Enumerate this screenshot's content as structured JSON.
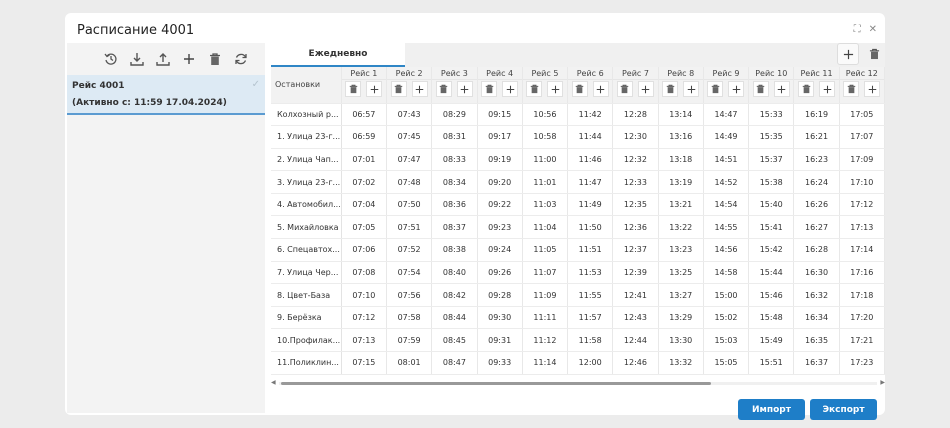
{
  "dialog": {
    "title": "Расписание 4001"
  },
  "trips": [
    {
      "name": "Рейс 4001",
      "active": "(Активно с: 11:59 17.04.2024)"
    }
  ],
  "tab": {
    "label": "Ежедневно"
  },
  "table": {
    "stops_header": "Остановки",
    "columns": [
      "Рейс 1",
      "Рейс 2",
      "Рейс 3",
      "Рейс 4",
      "Рейс 5",
      "Рейс 6",
      "Рейс 7",
      "Рейс 8",
      "Рейс 9",
      "Рейс 10",
      "Рейс 11",
      "Рейс 12"
    ],
    "rows": [
      {
        "stop": "Колхозный р...",
        "times": [
          "06:57",
          "07:43",
          "08:29",
          "09:15",
          "10:56",
          "11:42",
          "12:28",
          "13:14",
          "14:47",
          "15:33",
          "16:19",
          "17:05"
        ]
      },
      {
        "stop": "1. Улица 23-г...",
        "times": [
          "06:59",
          "07:45",
          "08:31",
          "09:17",
          "10:58",
          "11:44",
          "12:30",
          "13:16",
          "14:49",
          "15:35",
          "16:21",
          "17:07"
        ]
      },
      {
        "stop": "2. Улица Чап...",
        "times": [
          "07:01",
          "07:47",
          "08:33",
          "09:19",
          "11:00",
          "11:46",
          "12:32",
          "13:18",
          "14:51",
          "15:37",
          "16:23",
          "17:09"
        ]
      },
      {
        "stop": "3. Улица 23-г...",
        "times": [
          "07:02",
          "07:48",
          "08:34",
          "09:20",
          "11:01",
          "11:47",
          "12:33",
          "13:19",
          "14:52",
          "15:38",
          "16:24",
          "17:10"
        ]
      },
      {
        "stop": "4. Автомобил...",
        "times": [
          "07:04",
          "07:50",
          "08:36",
          "09:22",
          "11:03",
          "11:49",
          "12:35",
          "13:21",
          "14:54",
          "15:40",
          "16:26",
          "17:12"
        ]
      },
      {
        "stop": "5. Михайловка",
        "times": [
          "07:05",
          "07:51",
          "08:37",
          "09:23",
          "11:04",
          "11:50",
          "12:36",
          "13:22",
          "14:55",
          "15:41",
          "16:27",
          "17:13"
        ]
      },
      {
        "stop": "6. Спецавтох...",
        "times": [
          "07:06",
          "07:52",
          "08:38",
          "09:24",
          "11:05",
          "11:51",
          "12:37",
          "13:23",
          "14:56",
          "15:42",
          "16:28",
          "17:14"
        ]
      },
      {
        "stop": "7. Улица Чер...",
        "times": [
          "07:08",
          "07:54",
          "08:40",
          "09:26",
          "11:07",
          "11:53",
          "12:39",
          "13:25",
          "14:58",
          "15:44",
          "16:30",
          "17:16"
        ]
      },
      {
        "stop": "8. Цвет-База",
        "times": [
          "07:10",
          "07:56",
          "08:42",
          "09:28",
          "11:09",
          "11:55",
          "12:41",
          "13:27",
          "15:00",
          "15:46",
          "16:32",
          "17:18"
        ]
      },
      {
        "stop": "9. Берёзка",
        "times": [
          "07:12",
          "07:58",
          "08:44",
          "09:30",
          "11:11",
          "11:57",
          "12:43",
          "13:29",
          "15:02",
          "15:48",
          "16:34",
          "17:20"
        ]
      },
      {
        "stop": "10.Профилак...",
        "times": [
          "07:13",
          "07:59",
          "08:45",
          "09:31",
          "11:12",
          "11:58",
          "12:44",
          "13:30",
          "15:03",
          "15:49",
          "16:35",
          "17:21"
        ]
      },
      {
        "stop": "11.Поликлин...",
        "times": [
          "07:15",
          "08:01",
          "08:47",
          "09:33",
          "11:14",
          "12:00",
          "12:46",
          "13:32",
          "15:05",
          "15:51",
          "16:37",
          "17:23"
        ]
      }
    ]
  },
  "buttons": {
    "import": "Импорт",
    "export": "Экспорт"
  },
  "colors": {
    "accent": "#1e7ec8",
    "selected_bg": "#ddeaf4"
  },
  "icons": [
    "history-icon",
    "download-icon",
    "upload-icon",
    "plus-icon",
    "trash-icon",
    "refresh-icon",
    "expand-icon",
    "close-icon",
    "check-icon"
  ]
}
